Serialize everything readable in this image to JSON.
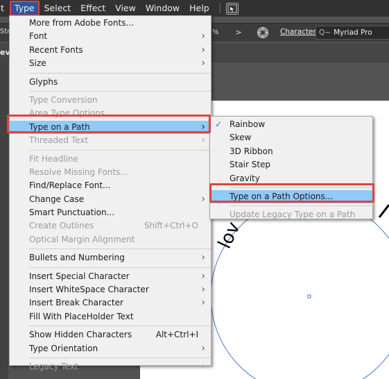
{
  "menubar": {
    "items": [
      "t",
      "Type",
      "Select",
      "Effect",
      "View",
      "Window",
      "Help"
    ]
  },
  "controlbar": {
    "left_fragment": "Str",
    "percent_fragment": "%",
    "arrow": ">",
    "character_label": "Character:",
    "search_glyph": "Q~",
    "font_value": "Myriad Pro"
  },
  "tabbar": {
    "fragment": "evi"
  },
  "type_menu": {
    "items": [
      {
        "label": "More from Adobe Fonts...",
        "disabled": false
      },
      {
        "label": "Font",
        "disabled": false,
        "submenu": true
      },
      {
        "label": "Recent Fonts",
        "disabled": false,
        "submenu": true
      },
      {
        "label": "Size",
        "disabled": false,
        "submenu": true
      },
      {
        "label": "Glyphs",
        "disabled": false
      },
      {
        "label": "Type Conversion",
        "disabled": true
      },
      {
        "label": "Area Type Options...",
        "disabled": true
      },
      {
        "label": "Type on a Path",
        "disabled": false,
        "submenu": true,
        "highlighted": true
      },
      {
        "label": "Threaded Text",
        "disabled": true,
        "submenu": true
      },
      {
        "label": "Fit Headline",
        "disabled": true
      },
      {
        "label": "Resolve Missing Fonts...",
        "disabled": true
      },
      {
        "label": "Find/Replace Font...",
        "disabled": false
      },
      {
        "label": "Change Case",
        "disabled": false,
        "submenu": true
      },
      {
        "label": "Smart Punctuation...",
        "disabled": false
      },
      {
        "label": "Create Outlines",
        "disabled": true,
        "shortcut": "Shift+Ctrl+O"
      },
      {
        "label": "Optical Margin Alignment",
        "disabled": true
      },
      {
        "label": "Bullets and Numbering",
        "disabled": false,
        "submenu": true
      },
      {
        "label": "Insert Special Character",
        "disabled": false,
        "submenu": true
      },
      {
        "label": "Insert WhiteSpace Character",
        "disabled": false,
        "submenu": true
      },
      {
        "label": "Insert Break Character",
        "disabled": false,
        "submenu": true
      },
      {
        "label": "Fill With PlaceHolder Text",
        "disabled": false
      },
      {
        "label": "Show Hidden Characters",
        "disabled": false,
        "shortcut": "Alt+Ctrl+I"
      },
      {
        "label": "Type Orientation",
        "disabled": false,
        "submenu": true
      },
      {
        "label": "Legacy Text",
        "disabled": true,
        "submenu": true
      }
    ]
  },
  "path_submenu": {
    "items": [
      {
        "label": "Rainbow",
        "checked": true
      },
      {
        "label": "Skew"
      },
      {
        "label": "3D Ribbon"
      },
      {
        "label": "Stair Step"
      },
      {
        "label": "Gravity"
      },
      {
        "label": "Type on a Path Options...",
        "highlighted": true
      },
      {
        "label": "Update Legacy Type on a Path",
        "disabled": true
      }
    ],
    "check_glyph": "✓"
  },
  "canvas": {
    "path_text_fragment": "lov"
  },
  "colors": {
    "highlight_outline": "#e0433f",
    "menu_highlight": "#91c9f7",
    "path_stroke": "#4a78d4"
  }
}
